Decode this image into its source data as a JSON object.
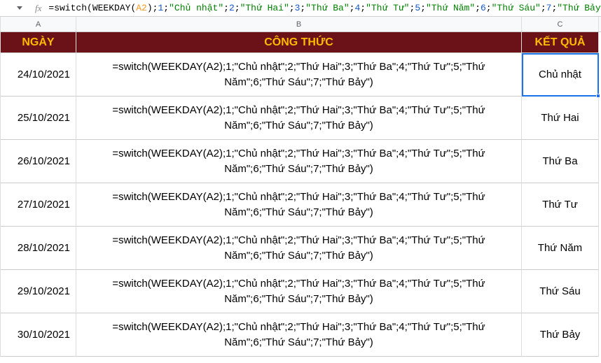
{
  "formula_bar": {
    "fx_label": "fx",
    "tokens": [
      {
        "cls": "tok-eq",
        "t": "="
      },
      {
        "cls": "tok-fn",
        "t": "switch"
      },
      {
        "cls": "tok-sep",
        "t": "("
      },
      {
        "cls": "tok-fn",
        "t": "WEEKDAY"
      },
      {
        "cls": "tok-sep",
        "t": "("
      },
      {
        "cls": "tok-ref",
        "t": "A2"
      },
      {
        "cls": "tok-sep",
        "t": ")"
      },
      {
        "cls": "tok-sep",
        "t": ";"
      },
      {
        "cls": "tok-num",
        "t": "1"
      },
      {
        "cls": "tok-sep",
        "t": ";"
      },
      {
        "cls": "tok-str",
        "t": "\"Chủ nhật\""
      },
      {
        "cls": "tok-sep",
        "t": ";"
      },
      {
        "cls": "tok-num",
        "t": "2"
      },
      {
        "cls": "tok-sep",
        "t": ";"
      },
      {
        "cls": "tok-str",
        "t": "\"Thứ Hai\""
      },
      {
        "cls": "tok-sep",
        "t": ";"
      },
      {
        "cls": "tok-num",
        "t": "3"
      },
      {
        "cls": "tok-sep",
        "t": ";"
      },
      {
        "cls": "tok-str",
        "t": "\"Thứ Ba\""
      },
      {
        "cls": "tok-sep",
        "t": ";"
      },
      {
        "cls": "tok-num",
        "t": "4"
      },
      {
        "cls": "tok-sep",
        "t": ";"
      },
      {
        "cls": "tok-str",
        "t": "\"Thứ Tư\""
      },
      {
        "cls": "tok-sep",
        "t": ";"
      },
      {
        "cls": "tok-num",
        "t": "5"
      },
      {
        "cls": "tok-sep",
        "t": ";"
      },
      {
        "cls": "tok-str",
        "t": "\"Thứ Năm\""
      },
      {
        "cls": "tok-sep",
        "t": ";"
      },
      {
        "cls": "tok-num",
        "t": "6"
      },
      {
        "cls": "tok-sep",
        "t": ";"
      },
      {
        "cls": "tok-str",
        "t": "\"Thứ Sáu\""
      },
      {
        "cls": "tok-sep",
        "t": ";"
      },
      {
        "cls": "tok-num",
        "t": "7"
      },
      {
        "cls": "tok-sep",
        "t": ";"
      },
      {
        "cls": "tok-str",
        "t": "\"Thứ Bảy\""
      },
      {
        "cls": "tok-sep",
        "t": ")"
      }
    ]
  },
  "columns": {
    "a": "A",
    "b": "B",
    "c": "C"
  },
  "headers": {
    "a": "NGÀY",
    "b": "CÔNG THỨC",
    "c": "KẾT QUẢ"
  },
  "formula_text": "=switch(WEEKDAY(A2);1;\"Chủ nhật\";2;\"Thứ Hai\";3;\"Thứ Ba\";4;\"Thứ Tư\";5;\"Thứ Năm\";6;\"Thứ Sáu\";7;\"Thứ Bảy\")",
  "rows": [
    {
      "date": "24/10/2021",
      "result": "Chủ nhật",
      "selected": true
    },
    {
      "date": "25/10/2021",
      "result": "Thứ Hai",
      "selected": false
    },
    {
      "date": "26/10/2021",
      "result": "Thứ Ba",
      "selected": false
    },
    {
      "date": "27/10/2021",
      "result": "Thứ Tư",
      "selected": false
    },
    {
      "date": "28/10/2021",
      "result": "Thứ Năm",
      "selected": false
    },
    {
      "date": "29/10/2021",
      "result": "Thứ Sáu",
      "selected": false
    },
    {
      "date": "30/10/2021",
      "result": "Thứ Bảy",
      "selected": false
    }
  ]
}
